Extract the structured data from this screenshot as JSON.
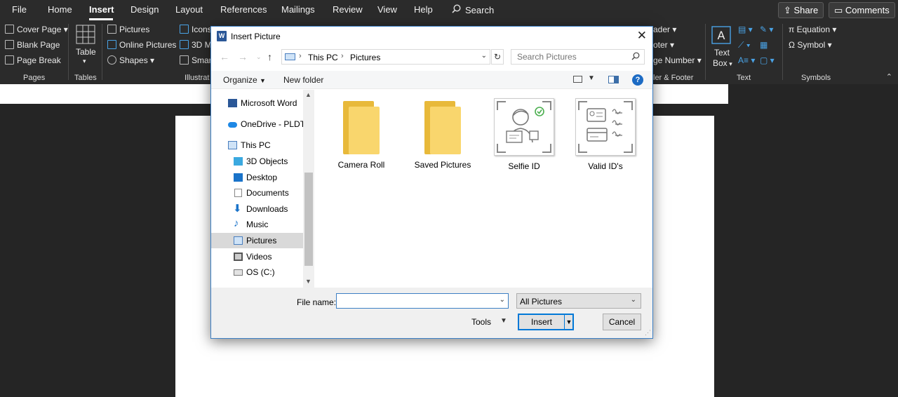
{
  "ribbon": {
    "menu_tabs": [
      "File",
      "Home",
      "Insert",
      "Design",
      "Layout",
      "References",
      "Mailings",
      "Review",
      "View",
      "Help"
    ],
    "search_label": "Search",
    "share_label": "Share",
    "comments_label": "Comments",
    "pages": {
      "cover_page": "Cover Page",
      "blank_page": "Blank Page",
      "page_break": "Page Break",
      "group_label": "Pages"
    },
    "tables": {
      "table": "Table",
      "group_label": "Tables"
    },
    "illustrations": {
      "pictures": "Pictures",
      "online_pictures": "Online Pictures",
      "shapes": "Shapes",
      "icons_partial": "Icons",
      "models_partial": "3D M",
      "smartart_partial": "Smar",
      "group_label_partial": "Illustrat"
    },
    "header_footer": {
      "header_partial": "ader",
      "footer_partial": "oter",
      "page_number_partial": "ge Number",
      "group_label_partial": "ler & Footer"
    },
    "text": {
      "text_box_line1": "Text",
      "text_box_line2": "Box",
      "group_label": "Text"
    },
    "symbols": {
      "equation": "Equation",
      "symbol": "Symbol",
      "group_label": "Symbols"
    }
  },
  "dialog": {
    "title": "Insert Picture",
    "breadcrumb": [
      "This PC",
      "Pictures"
    ],
    "search_placeholder": "Search Pictures",
    "organize": "Organize",
    "new_folder": "New folder",
    "nav_items": [
      {
        "label": "Microsoft Word",
        "icon": "word-icon"
      },
      {
        "label": "OneDrive - PLDT",
        "icon": "onedrive-icon"
      },
      {
        "label": "This PC",
        "icon": "pc-icon"
      },
      {
        "label": "3D Objects",
        "icon": "cube-icon"
      },
      {
        "label": "Desktop",
        "icon": "desktop-icon"
      },
      {
        "label": "Documents",
        "icon": "document-icon"
      },
      {
        "label": "Downloads",
        "icon": "download-icon"
      },
      {
        "label": "Music",
        "icon": "music-icon"
      },
      {
        "label": "Pictures",
        "icon": "pictures-icon",
        "selected": true
      },
      {
        "label": "Videos",
        "icon": "video-icon"
      },
      {
        "label": "OS (C:)",
        "icon": "drive-icon"
      }
    ],
    "files": [
      {
        "name": "Camera Roll",
        "kind": "folder"
      },
      {
        "name": "Saved Pictures",
        "kind": "folder"
      },
      {
        "name": "Selfie ID",
        "kind": "image"
      },
      {
        "name": "Valid ID's",
        "kind": "image"
      }
    ],
    "file_name_label": "File name:",
    "file_name_value": "",
    "filter_value": "All Pictures",
    "tools": "Tools",
    "insert": "Insert",
    "cancel": "Cancel"
  }
}
